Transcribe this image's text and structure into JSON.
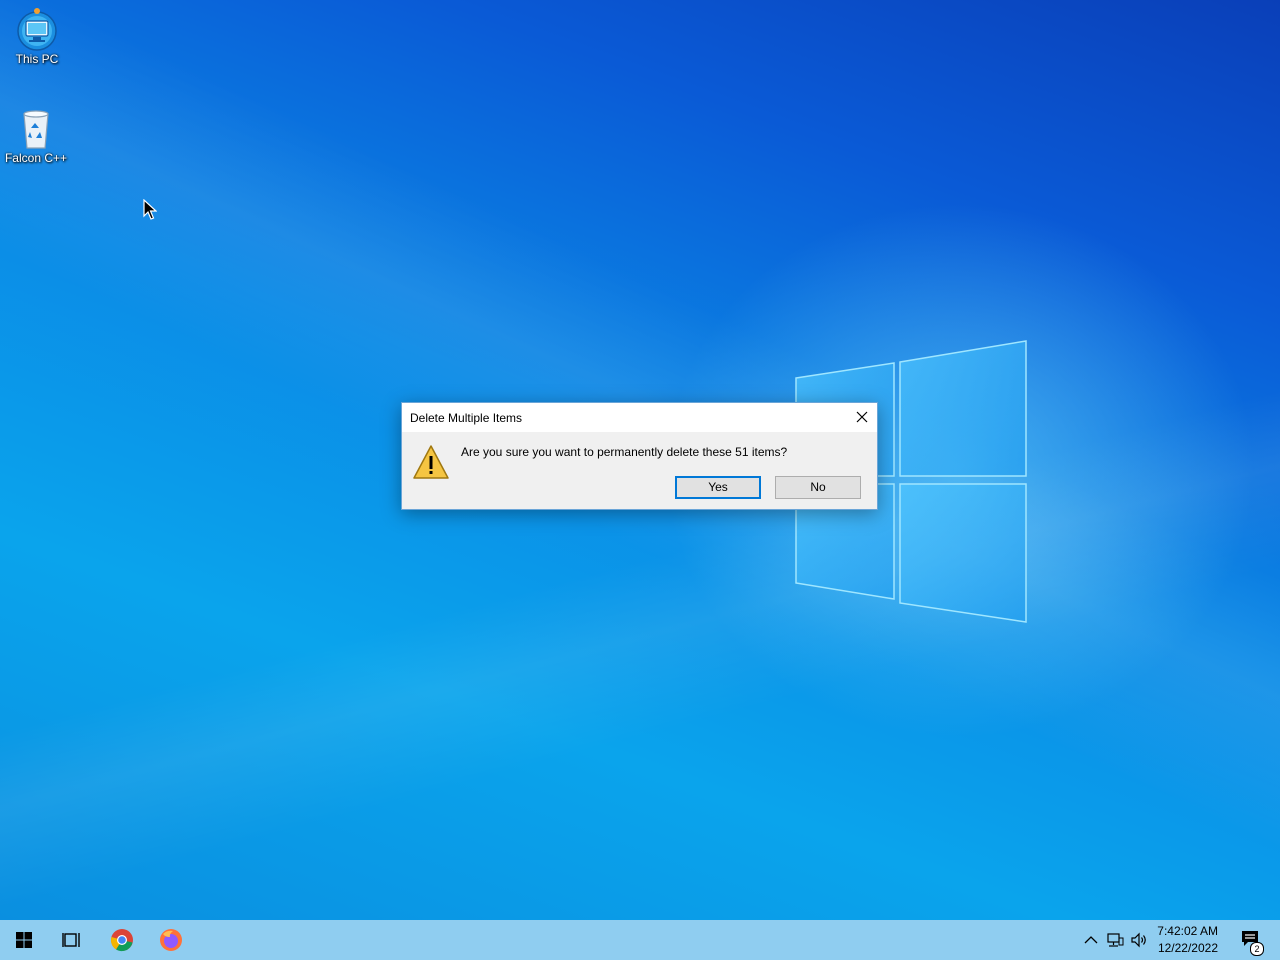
{
  "desktop": {
    "icons": [
      {
        "label": "This PC",
        "icon": "this-pc-icon"
      },
      {
        "label": "Falcon C++",
        "icon": "recycle-bin-icon"
      }
    ]
  },
  "dialog": {
    "title": "Delete Multiple Items",
    "message": "Are you sure you want to permanently delete these 51 items?",
    "yes_label": "Yes",
    "no_label": "No",
    "icon": "warning-icon"
  },
  "taskbar": {
    "pinned": [
      "start-icon",
      "task-view-icon",
      "chrome-icon",
      "firefox-icon"
    ],
    "tray": [
      "chevron-up-icon",
      "network-icon",
      "volume-icon"
    ],
    "time": "7:42:02 AM",
    "date": "12/22/2022",
    "notifications_count": "2"
  },
  "colors": {
    "accent": "#0078d7",
    "taskbar": "#8fcdf0",
    "dialog_body": "#f0f0f0"
  }
}
